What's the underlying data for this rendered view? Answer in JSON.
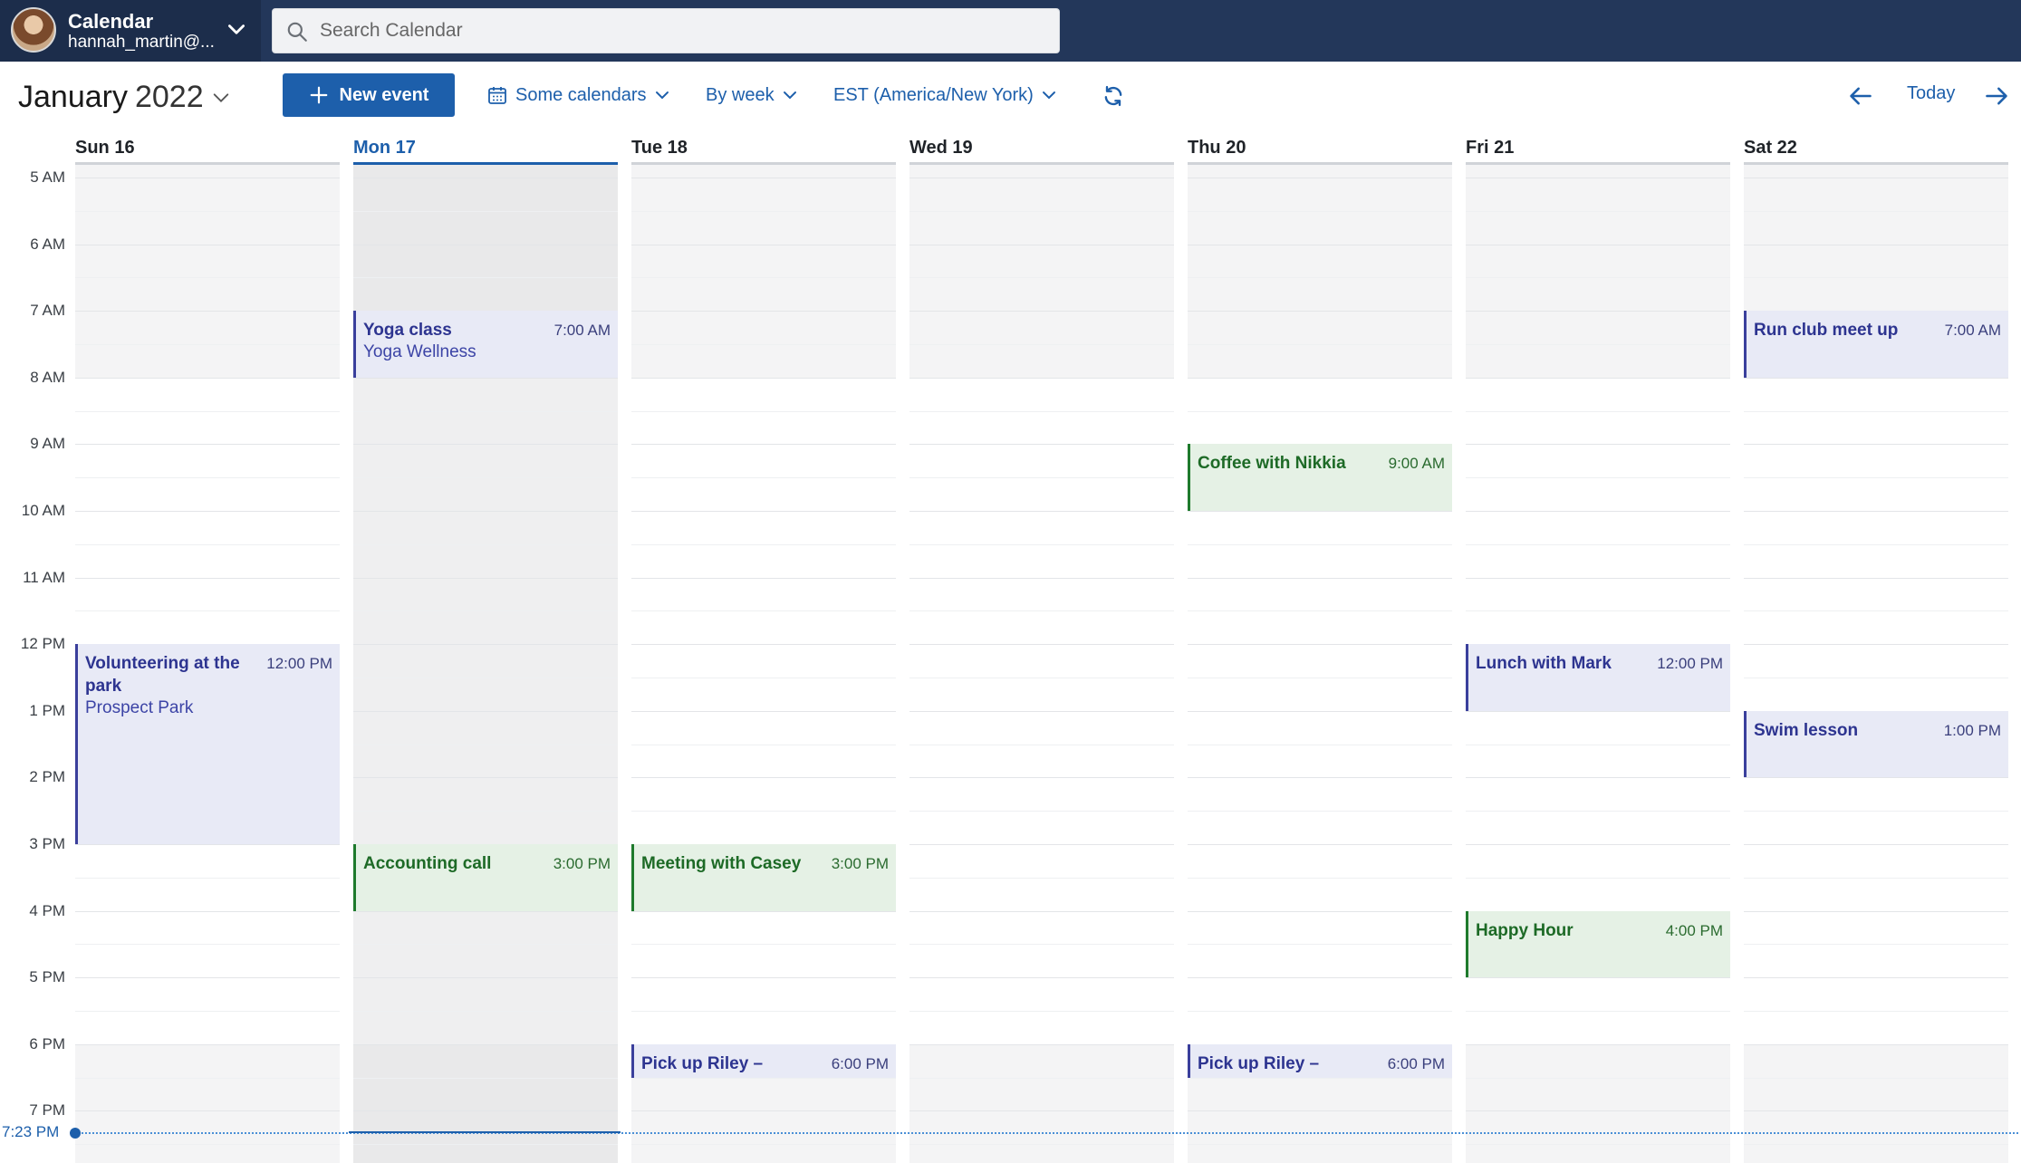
{
  "account": {
    "title": "Calendar",
    "email": "hannah_martin@..."
  },
  "search": {
    "placeholder": "Search Calendar"
  },
  "toolbar": {
    "month": "January",
    "year": "2022",
    "new_event_label": "New event",
    "calendars_label": "Some calendars",
    "view_label": "By week",
    "timezone_label": "EST (America/New York)",
    "today_label": "Today"
  },
  "colors": {
    "topbar": "#23375a",
    "accent": "#1d5fab",
    "event_blue": "#e8eaf6",
    "event_green": "#e5f1e5"
  },
  "hours": [
    "5 AM",
    "6 AM",
    "7 AM",
    "8 AM",
    "9 AM",
    "10 AM",
    "11 AM",
    "12 PM",
    "1 PM",
    "2 PM",
    "3 PM",
    "4 PM",
    "5 PM",
    "6 PM",
    "7 PM"
  ],
  "now_label": "7:23 PM",
  "days": [
    {
      "label": "Sun 16",
      "today": false,
      "events": [
        {
          "title": "Volunteering at the park",
          "time": "12:00 PM",
          "location": "Prospect Park",
          "start": 12,
          "end": 15,
          "color": "blue"
        }
      ]
    },
    {
      "label": "Mon 17",
      "today": true,
      "events": [
        {
          "title": "Yoga class",
          "time": "7:00 AM",
          "location": "Yoga Wellness",
          "start": 7,
          "end": 8,
          "color": "blue"
        },
        {
          "title": "Accounting call",
          "time": "3:00 PM",
          "location": "",
          "start": 15,
          "end": 16,
          "color": "green"
        }
      ]
    },
    {
      "label": "Tue 18",
      "today": false,
      "events": [
        {
          "title": "Meeting with Casey",
          "time": "3:00 PM",
          "location": "",
          "start": 15,
          "end": 16,
          "color": "green"
        },
        {
          "title": "Pick up Riley – McKlaren Elementary",
          "time": "6:00 PM",
          "location": "",
          "start": 18,
          "end": 18.5,
          "color": "blue"
        }
      ]
    },
    {
      "label": "Wed 19",
      "today": false,
      "events": []
    },
    {
      "label": "Thu 20",
      "today": false,
      "events": [
        {
          "title": "Coffee with Nikkia",
          "time": "9:00 AM",
          "location": "",
          "start": 9,
          "end": 10,
          "color": "green"
        },
        {
          "title": "Pick up Riley – McKlaren Elementary",
          "time": "6:00 PM",
          "location": "",
          "start": 18,
          "end": 18.5,
          "color": "blue"
        }
      ]
    },
    {
      "label": "Fri 21",
      "today": false,
      "events": [
        {
          "title": "Lunch with Mark",
          "time": "12:00 PM",
          "location": "",
          "start": 12,
          "end": 13,
          "color": "blue"
        },
        {
          "title": "Happy Hour",
          "time": "4:00 PM",
          "location": "",
          "start": 16,
          "end": 17,
          "color": "green"
        }
      ]
    },
    {
      "label": "Sat 22",
      "today": false,
      "events": [
        {
          "title": "Run club meet up",
          "time": "7:00 AM",
          "location": "",
          "start": 7,
          "end": 8,
          "color": "blue"
        },
        {
          "title": "Swim lesson",
          "time": "1:00 PM",
          "location": "",
          "start": 13,
          "end": 14,
          "color": "blue"
        }
      ]
    }
  ]
}
